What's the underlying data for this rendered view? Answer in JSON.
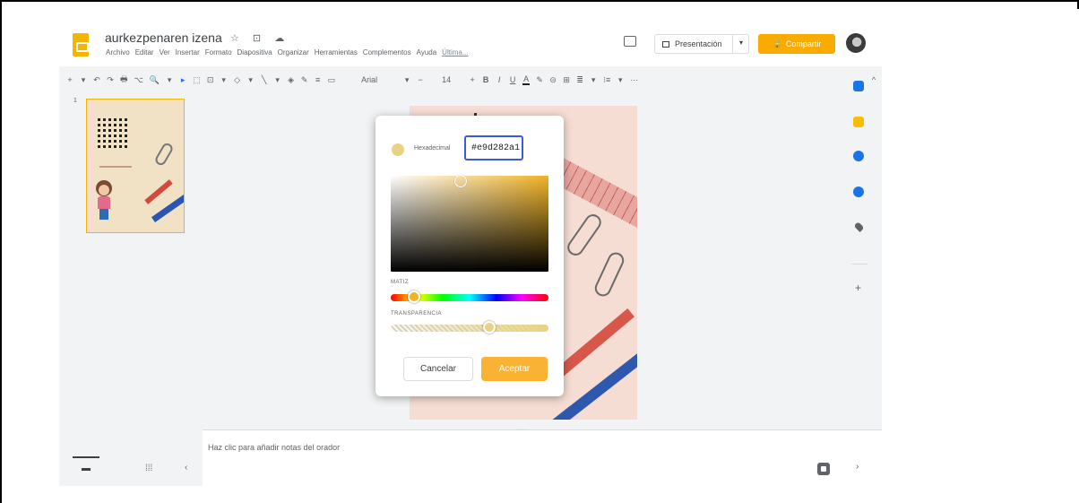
{
  "header": {
    "doc_title": "aurkezpenaren izena",
    "title_icons": "☆ ⊡ ☁",
    "present_label": "Presentación",
    "present_dropdown": "▾",
    "share_label": "Compartir",
    "share_icon": "🔒"
  },
  "menu": [
    "Archivo",
    "Editar",
    "Ver",
    "Insertar",
    "Formato",
    "Diapositiva",
    "Organizar",
    "Herramientas",
    "Complementos",
    "Ayuda",
    "Última..."
  ],
  "toolbar": {
    "items": [
      "+",
      "▾",
      "↶",
      "↷",
      "🖶",
      "⌥",
      "🔍",
      "▾",
      "▸",
      "⬚",
      "⊡",
      "▾",
      "◇",
      "▾",
      "╲",
      "▾",
      "◈",
      "✎",
      "≡",
      "▭"
    ],
    "font": "Arial",
    "font_dropdown": "▾",
    "size_minus": "−",
    "size": "14",
    "size_plus": "+",
    "bold": "B",
    "italic": "I",
    "underline": "U",
    "text_color": "A",
    "highlight": "✎",
    "tail": [
      "⊝",
      "⊞",
      "≣",
      "▾",
      "⁝≡",
      "▾",
      "···"
    ],
    "collapse": "^"
  },
  "filmstrip": {
    "slide_number": "1"
  },
  "notes": {
    "placeholder": "Haz clic para añadir notas del orador",
    "handle": "····"
  },
  "view_tabs": {
    "filmstrip_view": "▬",
    "grid_view": "⁞⁞⁞",
    "collapse": "‹"
  },
  "side_panel": {
    "add": "+",
    "expand": "›"
  },
  "color_dialog": {
    "hex_label": "Hexadecimal",
    "hex_value": "#e9d282a1",
    "hue_label": "MATIZ",
    "alpha_label": "TRANSPARENCIA",
    "hue": 0.12,
    "transparency": 0.64,
    "current_color": "#e9d282",
    "cancel_label": "Cancelar",
    "accept_label": "Aceptar"
  },
  "colors": {
    "accent": "#f9ab00",
    "accept": "#f9b233",
    "focus": "#3b5bdb"
  }
}
